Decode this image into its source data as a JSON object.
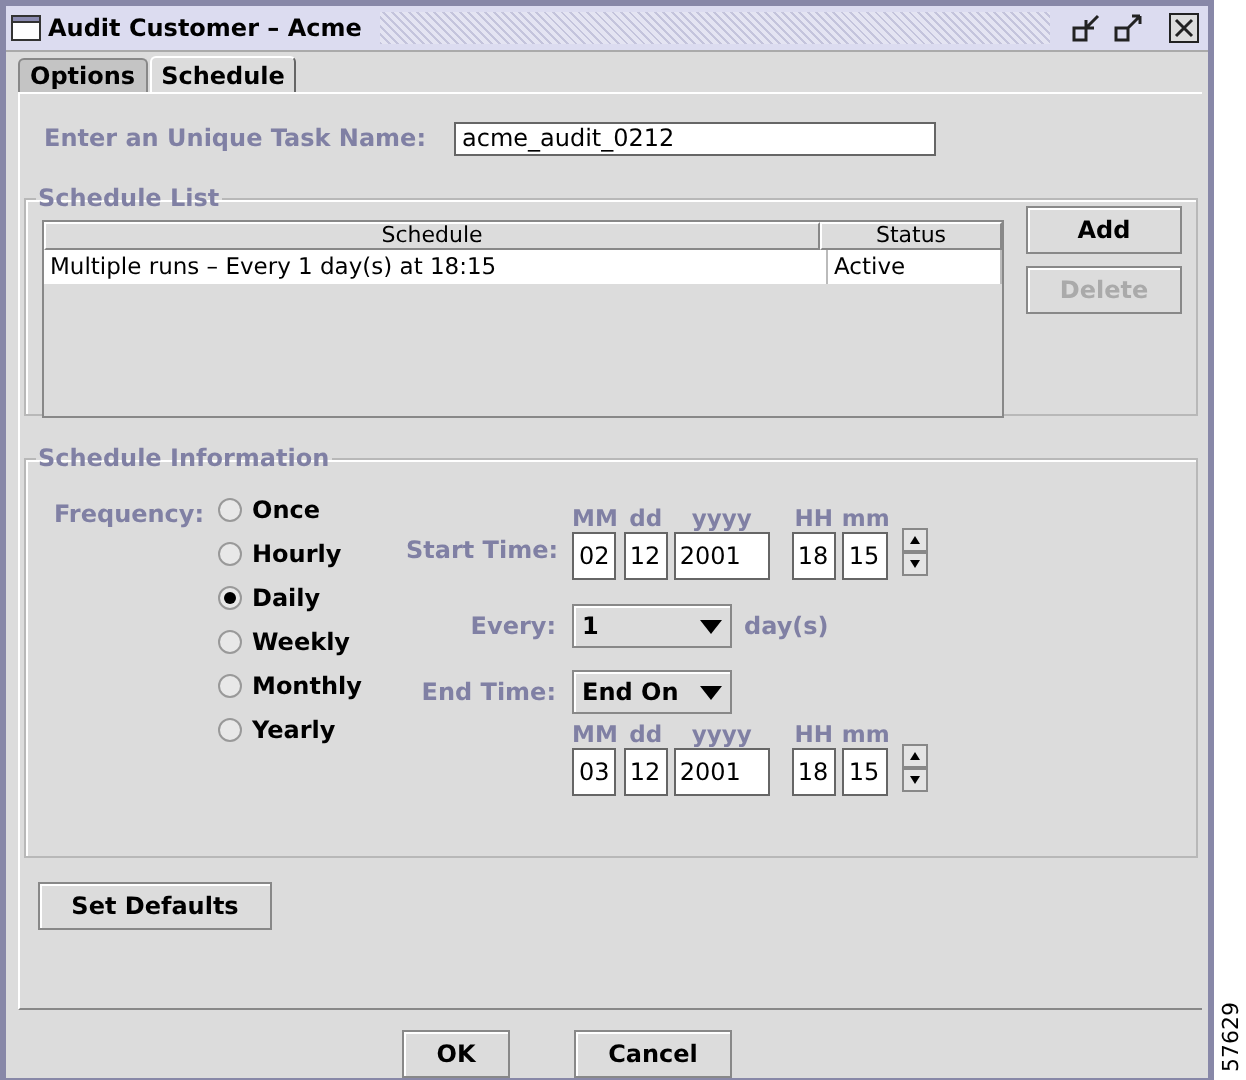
{
  "window": {
    "title": "Audit Customer – Acme"
  },
  "tabs": [
    {
      "label": "Options",
      "selected": false
    },
    {
      "label": "Schedule",
      "selected": true
    }
  ],
  "task_name": {
    "label": "Enter an Unique Task Name:",
    "value": "acme_audit_0212"
  },
  "schedule_list": {
    "title": "Schedule List",
    "columns": [
      "Schedule",
      "Status"
    ],
    "rows": [
      {
        "schedule": "Multiple runs – Every 1 day(s) at 18:15",
        "status": "Active"
      }
    ],
    "buttons": [
      {
        "label": "Add",
        "disabled": false
      },
      {
        "label": "Delete",
        "disabled": true
      }
    ]
  },
  "schedule_information": {
    "title": "Schedule Information",
    "frequency_label": "Frequency:",
    "frequencies": [
      {
        "label": "Once",
        "selected": false
      },
      {
        "label": "Hourly",
        "selected": false
      },
      {
        "label": "Daily",
        "selected": true
      },
      {
        "label": "Weekly",
        "selected": false
      },
      {
        "label": "Monthly",
        "selected": false
      },
      {
        "label": "Yearly",
        "selected": false
      }
    ],
    "start_time": {
      "label": "Start Time:",
      "headers": [
        "MM",
        "dd",
        "yyyy",
        "HH",
        "mm"
      ],
      "values": [
        "02",
        "12",
        "2001",
        "18",
        "15"
      ]
    },
    "every": {
      "label": "Every:",
      "value": "1",
      "unit": "day(s)"
    },
    "end_time": {
      "label": "End Time:",
      "mode": "End On",
      "headers": [
        "MM",
        "dd",
        "yyyy",
        "HH",
        "mm"
      ],
      "values": [
        "03",
        "12",
        "2001",
        "18",
        "15"
      ]
    }
  },
  "set_defaults": "Set Defaults",
  "dialog_buttons": [
    "OK",
    "Cancel"
  ],
  "figure_number": "57629"
}
